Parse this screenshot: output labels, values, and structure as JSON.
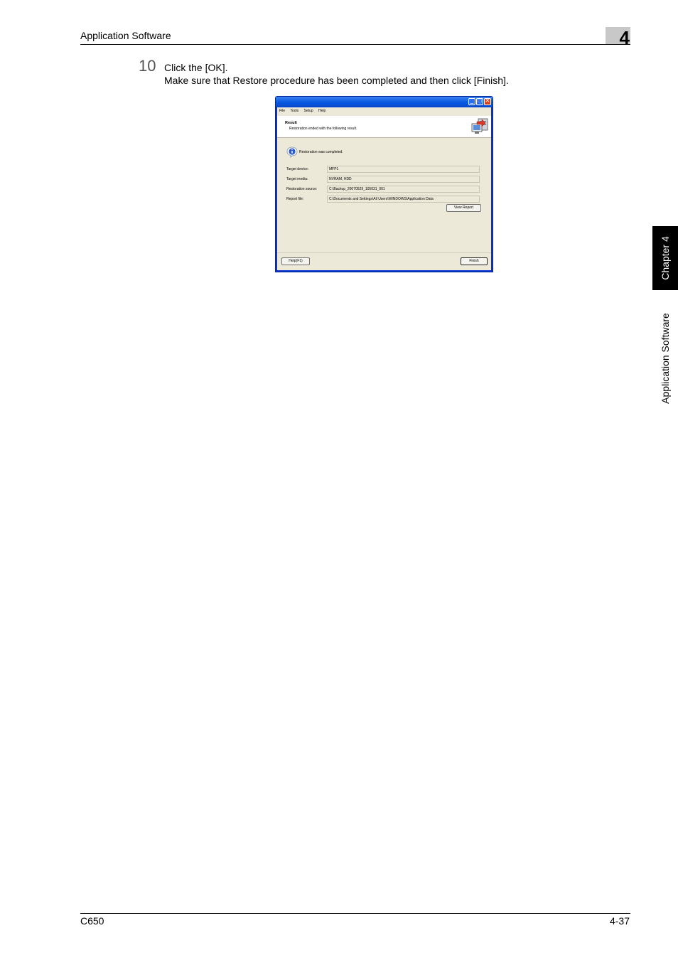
{
  "header": {
    "title": "Application Software",
    "chapter_number": "4"
  },
  "step": {
    "number": "10",
    "line1": "Click the [OK].",
    "line2": "Make sure that Restore procedure has been completed and then click [Finish]."
  },
  "side": {
    "tab_label": "Chapter 4",
    "section_label": "Application Software"
  },
  "footer": {
    "model": "C650",
    "page": "4-37"
  },
  "dialog": {
    "menu": [
      "File",
      "Tools",
      "Setup",
      "Help"
    ],
    "banner_title": "Result",
    "banner_subtitle": "Restoration ended with the following result.",
    "message": "Restoration was completed.",
    "fields": [
      {
        "label": "Target device:",
        "value": "MFP1"
      },
      {
        "label": "Target media:",
        "value": "NVRAM, HDD"
      },
      {
        "label": "Restoration source:",
        "value": "C:\\Backup_20070529_105031_001"
      },
      {
        "label": "Report file:",
        "value": "C:\\Documents and Settings\\All Users\\WINDOWS\\Application Data"
      }
    ],
    "view_report_button": "View Report",
    "help_button": "Help(F1)",
    "finish_button": "Finish"
  }
}
